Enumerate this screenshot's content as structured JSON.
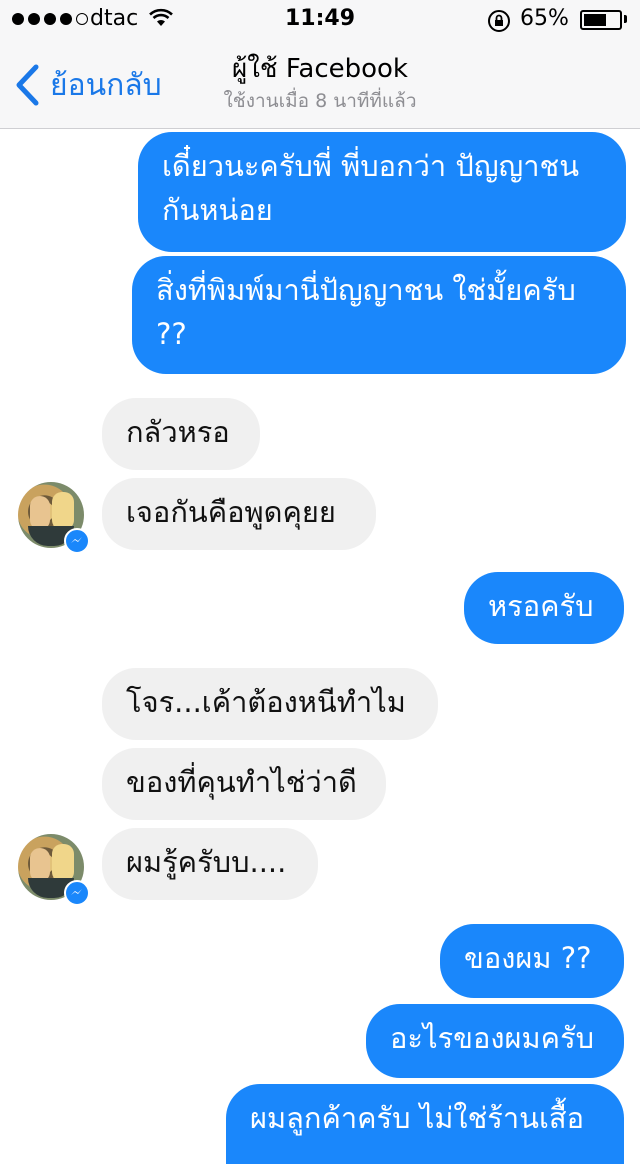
{
  "status_bar": {
    "carrier": "dtac",
    "time": "11:49",
    "battery_percent": "65%",
    "battery_level": 0.65
  },
  "nav": {
    "back_label": "ย้อนกลับ",
    "title": "ผู้ใช้ Facebook",
    "subtitle": "ใช้งานเมื่อ 8 นาทีที่แล้ว"
  },
  "messages": [
    {
      "from": "me",
      "lines": [
        "เดี๋ยวนะครับพี่ พี่บอกว่า ปัญญาชน",
        "กันหน่อย"
      ]
    },
    {
      "from": "me",
      "lines": [
        "สิ่งที่พิมพ์มานี่ปัญญาชน ใช่มั้ยครับ",
        "??"
      ]
    },
    {
      "from": "them",
      "lines": [
        "กลัวหรอ"
      ]
    },
    {
      "from": "them",
      "lines": [
        "เจอกันคือพูดคุยย"
      ]
    },
    {
      "from": "me",
      "lines": [
        "หรอครับ"
      ]
    },
    {
      "from": "them",
      "lines": [
        "โจร...เค้าต้องหนีทำไม"
      ]
    },
    {
      "from": "them",
      "lines": [
        "ของที่คุนทำไช่ว่าดี"
      ]
    },
    {
      "from": "them",
      "lines": [
        "ผมรู้ครับบ...."
      ]
    },
    {
      "from": "me",
      "lines": [
        "ของผม ??"
      ]
    },
    {
      "from": "me",
      "lines": [
        "อะไรของผมครับ"
      ]
    },
    {
      "from": "me",
      "lines": [
        "ผมลูกค้าครับ ไม่ใช่ร้านเสื้อ"
      ]
    }
  ],
  "colors": {
    "outgoing_bubble": "#1a87fb",
    "incoming_bubble": "#f0f0f0",
    "accent": "#1a78e8"
  }
}
